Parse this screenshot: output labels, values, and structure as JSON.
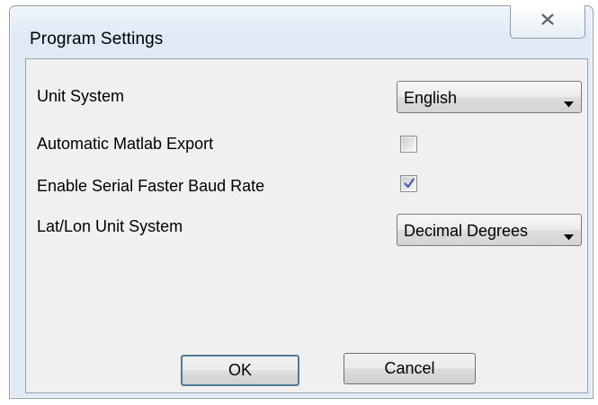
{
  "window": {
    "title": "Program Settings",
    "close_icon": "close-x"
  },
  "settings": [
    {
      "label": "Unit System",
      "control": "dropdown",
      "value": "English"
    },
    {
      "label": "Automatic Matlab Export",
      "control": "checkbox",
      "checked": false
    },
    {
      "label": "Enable Serial Faster Baud Rate",
      "control": "checkbox",
      "checked": true
    },
    {
      "label": "Lat/Lon Unit System",
      "control": "dropdown",
      "value": "Decimal Degrees"
    }
  ],
  "buttons": {
    "ok": "OK",
    "cancel": "Cancel"
  },
  "colors": {
    "checkmark": "#4a5bb8",
    "window_border": "#8a96a3",
    "client_bg": "#f0f0f0"
  }
}
